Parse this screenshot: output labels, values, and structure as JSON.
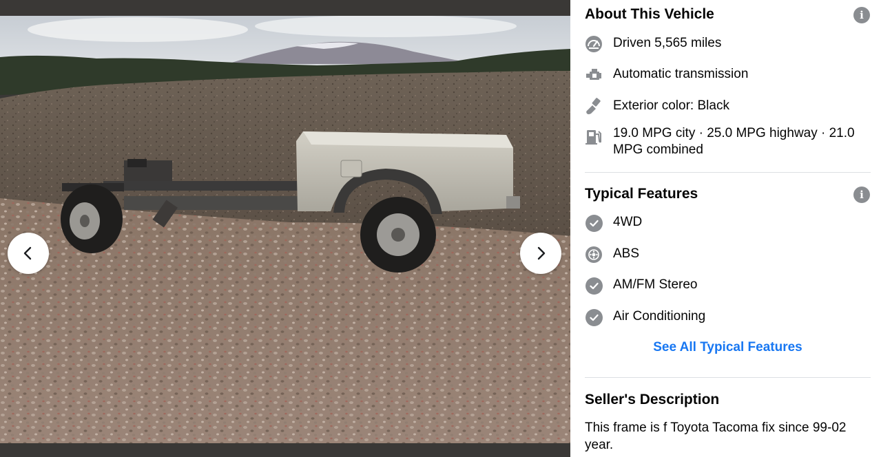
{
  "photo": {
    "alt": "Truck frame with bed and wheels parked on gravel in front of a dirt pile"
  },
  "nav": {
    "prev_icon": "chevron-left-icon",
    "next_icon": "chevron-right-icon"
  },
  "about": {
    "title": "About This Vehicle",
    "info_icon": "i",
    "items": [
      {
        "icon": "speedometer-icon",
        "text": "Driven 5,565 miles"
      },
      {
        "icon": "engine-icon",
        "text": "Automatic transmission"
      },
      {
        "icon": "paint-brush-icon",
        "text": "Exterior color: Black"
      },
      {
        "icon": "fuel-pump-icon",
        "text": "19.0 MPG city · 25.0 MPG highway · 21.0 MPG combined"
      }
    ]
  },
  "features": {
    "title": "Typical Features",
    "info_icon": "i",
    "items": [
      {
        "icon": "checkmark-icon",
        "text": "4WD"
      },
      {
        "icon": "brake-disc-icon",
        "text": "ABS"
      },
      {
        "icon": "checkmark-icon",
        "text": "AM/FM Stereo"
      },
      {
        "icon": "checkmark-icon",
        "text": "Air Conditioning"
      }
    ],
    "see_all": "See All Typical Features"
  },
  "seller": {
    "title": "Seller's Description",
    "text": "This frame is f Toyota Tacoma fix since 99-02 year."
  },
  "colors": {
    "link": "#1877f2",
    "icon_gray": "#8a8d91",
    "text": "#050505"
  }
}
